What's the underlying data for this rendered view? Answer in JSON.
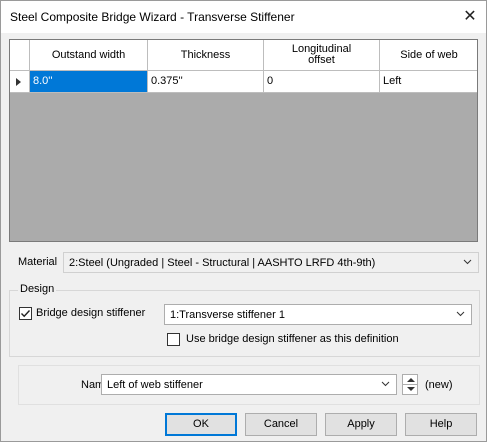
{
  "window": {
    "title": "Steel Composite Bridge Wizard - Transverse Stiffener",
    "close_glyph": "✕"
  },
  "grid": {
    "columns": [
      "Outstand width",
      "Thickness",
      "Longitudinal offset",
      "Side of web"
    ],
    "rows": [
      {
        "cells": [
          "8.0''",
          "0.375''",
          "0",
          "Left"
        ],
        "selected_col": 0
      }
    ]
  },
  "material": {
    "label": "Material",
    "value": "2:Steel (Ungraded | Steel - Structural | AASHTO LRFD 4th-9th)"
  },
  "design": {
    "caption": "Design",
    "bridge_design_stiffener": {
      "label": "Bridge design stiffener",
      "checked": true,
      "value": "1:Transverse stiffener 1"
    },
    "use_as_definition": {
      "label": "Use bridge design stiffener as this definition",
      "checked": false
    }
  },
  "name": {
    "label": "Name",
    "value": "Left of web stiffener",
    "suffix": "(new)"
  },
  "buttons": {
    "ok": "OK",
    "cancel": "Cancel",
    "apply": "Apply",
    "help": "Help"
  }
}
